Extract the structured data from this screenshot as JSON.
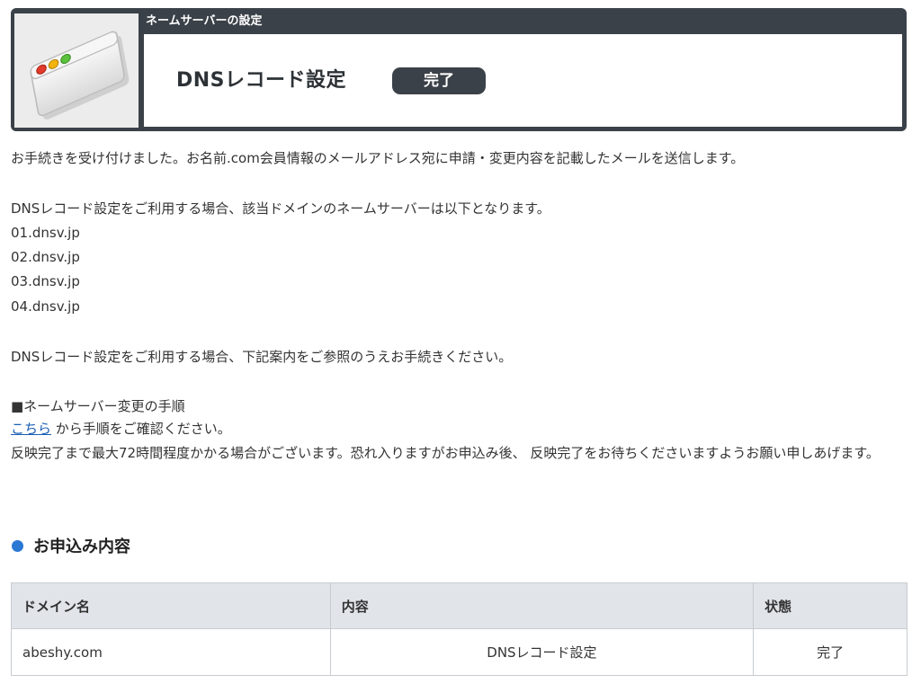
{
  "header": {
    "caption": "ネームサーバーの設定",
    "title": "DNSレコード設定",
    "badge": "完了",
    "icon": "browser-window-icon"
  },
  "body": {
    "line_received": "お手続きを受け付けました。お名前.com会員情報のメールアドレス宛に申請・変更内容を記載したメールを送信します。",
    "line_nameserver_intro": "DNSレコード設定をご利用する場合、該当ドメインのネームサーバーは以下となります。",
    "nameservers": [
      "01.dnsv.jp",
      "02.dnsv.jp",
      "03.dnsv.jp",
      "04.dnsv.jp"
    ],
    "line_refer": "DNSレコード設定をご利用する場合、下記案内をご参照のうえお手続きください。",
    "steps_heading": "■ネームサーバー変更の手順",
    "steps_link": "こちら",
    "steps_link_suffix": " から手順をご確認ください。",
    "notice": "反映完了まで最大72時間程度かかる場合がございます。恐れ入りますがお申込み後、 反映完了をお待ちくださいますようお願い申しあげます。"
  },
  "section": {
    "title": "お申込み内容",
    "dot_color": "#2b78d4"
  },
  "table": {
    "headers": [
      "ドメイン名",
      "内容",
      "状態"
    ],
    "rows": [
      [
        "abeshy.com",
        "DNSレコード設定",
        "完了"
      ]
    ]
  }
}
